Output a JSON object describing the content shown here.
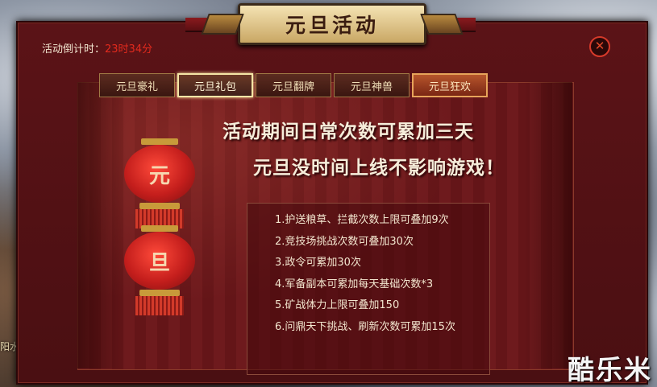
{
  "window": {
    "title": "元旦活动"
  },
  "countdown": {
    "label": "活动倒计时：",
    "value": "23时34分"
  },
  "close_icon": "close-x",
  "tabs": [
    {
      "label": "元旦豪礼"
    },
    {
      "label": "元旦礼包"
    },
    {
      "label": "元旦翻牌"
    },
    {
      "label": "元旦神兽"
    },
    {
      "label": "元旦狂欢"
    }
  ],
  "active_tab": "元旦礼包",
  "headline": {
    "line1": "活动期间日常次数可累加三天",
    "line2": "元旦没时间上线不影响游戏！"
  },
  "lanterns": [
    {
      "char": "元"
    },
    {
      "char": "旦"
    }
  ],
  "rules": [
    "1.护送粮草、拦截次数上限可叠加9次",
    "2.竞技场挑战次数可叠加30次",
    "3.政令可累加30次",
    "4.军备副本可累加每天基础次数*3",
    "5.矿战体力上限可叠加150",
    "6.问鼎天下挑战、刷新次数可累加15次"
  ],
  "background": {
    "map_label": "阳水域"
  },
  "watermark": "酷乐米",
  "colors": {
    "panel": "#4a0f12",
    "countdown_value": "#e22a1d",
    "title_plate": "#f4e3b3"
  }
}
